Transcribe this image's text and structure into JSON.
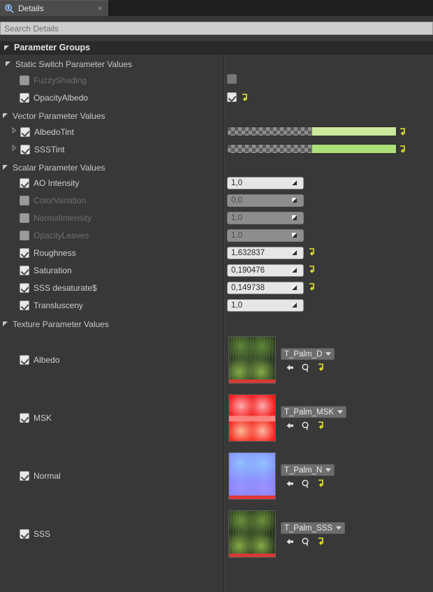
{
  "window": {
    "tab_label": "Details",
    "tab_icon": "details-magnifier-icon",
    "close_label": "×"
  },
  "search": {
    "placeholder": "Search Details",
    "value": ""
  },
  "colors": {
    "panel_bg": "#383838",
    "header_bg": "#2a2a2a",
    "tab_bg": "#4b4b4b",
    "search_bg": "#cdcdcd",
    "revert_yellow": "#e8e830",
    "albedo_tint": "#cce89c",
    "sss_tint": "#aee07a",
    "text": "#cfcfcf",
    "text_dim": "#6f6f6f"
  },
  "root_category": {
    "label": "Parameter Groups",
    "expanded": true
  },
  "groups": [
    {
      "id": "static-switch-parameter-values",
      "label": "Static Switch Parameter Values",
      "expanded": true,
      "rows": [
        {
          "name": "FuzzyShading",
          "checked": false,
          "enabled": false,
          "widget": "checkbox",
          "widget_checked": false,
          "revert": false
        },
        {
          "name": "OpacityAlbedo",
          "checked": true,
          "enabled": true,
          "widget": "checkbox",
          "widget_checked": true,
          "revert": true
        }
      ]
    },
    {
      "id": "vector-parameter-values",
      "label": "Vector Parameter Values",
      "expanded": true,
      "rows": [
        {
          "name": "AlbedoTint",
          "checked": true,
          "enabled": true,
          "expandable": true,
          "widget": "color",
          "color": "#cce89c",
          "revert": true
        },
        {
          "name": "SSSTint",
          "checked": true,
          "enabled": true,
          "expandable": true,
          "widget": "color",
          "color": "#aee07a",
          "revert": true
        }
      ]
    },
    {
      "id": "scalar-parameter-values",
      "label": "Scalar Parameter Values",
      "expanded": true,
      "rows": [
        {
          "name": "AO Intensity",
          "checked": true,
          "enabled": true,
          "widget": "number",
          "value": "1,0",
          "revert": false
        },
        {
          "name": "ColorVariation",
          "checked": false,
          "enabled": false,
          "widget": "number",
          "value": "0,0",
          "revert": false
        },
        {
          "name": "NormalIntensity",
          "checked": false,
          "enabled": false,
          "widget": "number",
          "value": "1,0",
          "revert": false
        },
        {
          "name": "OpacityLeaves",
          "checked": false,
          "enabled": false,
          "widget": "number",
          "value": "1,0",
          "revert": false
        },
        {
          "name": "Roughness",
          "checked": true,
          "enabled": true,
          "widget": "number",
          "value": "1,632837",
          "revert": true
        },
        {
          "name": "Saturation",
          "checked": true,
          "enabled": true,
          "widget": "number",
          "value": "0,190476",
          "revert": true
        },
        {
          "name": "SSS desaturate$",
          "checked": true,
          "enabled": true,
          "widget": "number",
          "value": "0,149738",
          "revert": true
        },
        {
          "name": "Translusceny",
          "checked": true,
          "enabled": true,
          "widget": "number",
          "value": "1,0",
          "revert": false
        }
      ]
    },
    {
      "id": "texture-parameter-values",
      "label": "Texture Parameter Values",
      "expanded": true,
      "rows": [
        {
          "name": "Albedo",
          "checked": true,
          "enabled": true,
          "widget": "texture",
          "asset": "T_Palm_D",
          "thumb": "palm-albedo-thumbnail"
        },
        {
          "name": "MSK",
          "checked": true,
          "enabled": true,
          "widget": "texture",
          "asset": "T_Palm_MSK",
          "thumb": "palm-mask-thumbnail"
        },
        {
          "name": "Normal",
          "checked": true,
          "enabled": true,
          "widget": "texture",
          "asset": "T_Palm_N",
          "thumb": "palm-normal-thumbnail"
        },
        {
          "name": "SSS",
          "checked": true,
          "enabled": true,
          "widget": "texture",
          "asset": "T_Palm_SSS",
          "thumb": "palm-sss-thumbnail"
        }
      ]
    }
  ],
  "texture_actions": {
    "use_selected": "use-selected-asset-icon",
    "browse": "browse-to-asset-icon",
    "reset": "reset-to-default-icon"
  }
}
